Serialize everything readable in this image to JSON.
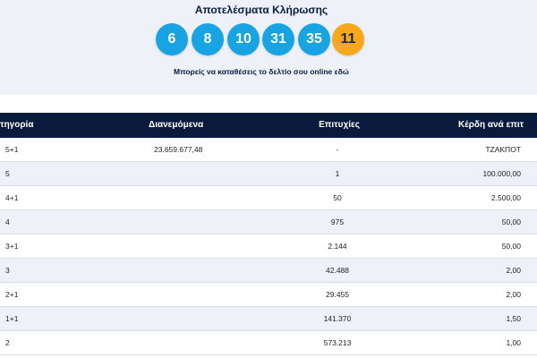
{
  "header": {
    "title": "Αποτελέσματα Κλήρωσης",
    "numbers": [
      "6",
      "8",
      "10",
      "31",
      "35"
    ],
    "joker": "11",
    "online_note": "Μπορείς να καταθέσεις το δελτίο σου online εδώ"
  },
  "colors": {
    "ball": "#18a3e3",
    "joker_ball": "#f7a81b",
    "table_header": "#0a1a3c",
    "top_background": "#eef1f8"
  },
  "table": {
    "columns": [
      "ητηγορία",
      "Διανεμόμενα",
      "Επιτυχίες",
      "Κέρδη ανά επιτ"
    ],
    "rows": [
      {
        "category": "5+1",
        "distributed": "23.659.677,48",
        "wins": "-",
        "prize": "ΤΖΑΚΠΟΤ"
      },
      {
        "category": "5",
        "distributed": "",
        "wins": "1",
        "prize": "100.000,00"
      },
      {
        "category": "4+1",
        "distributed": "",
        "wins": "50",
        "prize": "2.500,00"
      },
      {
        "category": "4",
        "distributed": "",
        "wins": "975",
        "prize": "50,00"
      },
      {
        "category": "3+1",
        "distributed": "",
        "wins": "2.144",
        "prize": "50,00"
      },
      {
        "category": "3",
        "distributed": "",
        "wins": "42.488",
        "prize": "2,00"
      },
      {
        "category": "2+1",
        "distributed": "",
        "wins": "29.455",
        "prize": "2,00"
      },
      {
        "category": "1+1",
        "distributed": "",
        "wins": "141.370",
        "prize": "1,50"
      },
      {
        "category": "2",
        "distributed": "",
        "wins": "573.213",
        "prize": "1,00"
      }
    ]
  }
}
